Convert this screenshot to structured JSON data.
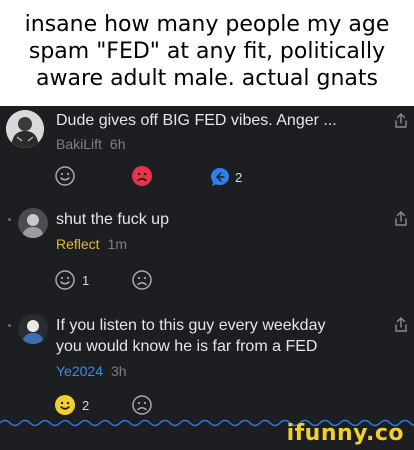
{
  "caption": "insane how many people my age spam \"FED\" at any fit, politically aware adult male. actual gnats",
  "comments": [
    {
      "text": "Dude gives off BIG FED vibes. Anger ...",
      "username": "BakiLift",
      "time": "6h",
      "username_color": "#7d7f85",
      "reactions": {
        "smile_icon": "smile-outline-icon",
        "frown_icon": "frown-red-icon",
        "reply_icon": "reply-bubble-icon",
        "reply_count": "2"
      }
    },
    {
      "text": "shut the fuck up",
      "username": "Reflect",
      "time": "1m",
      "username_color": "#e2b93b",
      "reactions": {
        "smile_icon": "smile-outline-icon",
        "smile_count": "1",
        "frown_icon": "frown-outline-icon"
      }
    },
    {
      "text": "If you listen to this guy every weekday\nyou would know he is far from a FED",
      "username": "Ye2024",
      "time": "3h",
      "username_color": "#3a8ee6",
      "reactions": {
        "smile_icon": "smile-filled-yellow-icon",
        "smile_count": "2",
        "frown_icon": "frown-outline-icon"
      }
    }
  ],
  "watermark": "ifunny.co",
  "colors": {
    "background": "#1d1e22",
    "text": "#e6e6e8",
    "muted": "#7d7f85",
    "accent_blue": "#2f80ed",
    "accent_red": "#e8334a",
    "accent_yellow": "#f3cf2e"
  }
}
